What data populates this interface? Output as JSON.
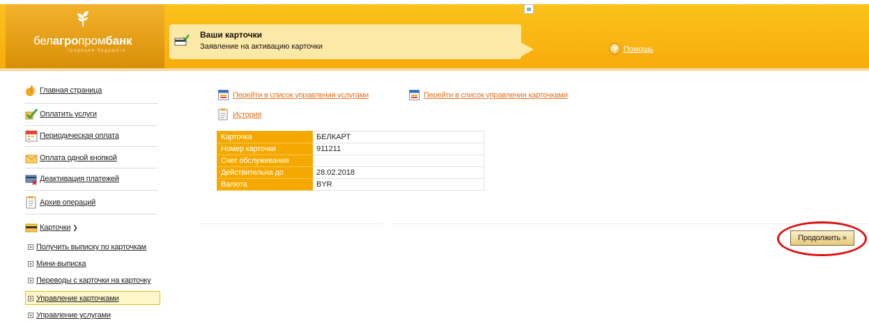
{
  "header": {
    "logo": {
      "part1": "бел",
      "part2": "агро",
      "part3": "пром",
      "part4": "банк",
      "tagline": "традиции будущего"
    },
    "notice": {
      "title": "Ваши карточки",
      "subtitle": "Заявление на активацию карточки"
    },
    "help_label": "Помощь",
    "colors": {
      "accent": "#f7ac0c",
      "notice_bg": "#fde9a7"
    }
  },
  "sidebar": {
    "items": [
      {
        "label": "Главная страница",
        "icon": "hand-icon"
      },
      {
        "label": "Оплатить услуги",
        "icon": "checkmark-icon"
      },
      {
        "label": "Периодическая оплата",
        "icon": "calendar-icon"
      },
      {
        "label": "Оплата одной кнопкой",
        "icon": "envelope-icon"
      },
      {
        "label": "Деактивация платежей",
        "icon": "card-cancel-icon"
      },
      {
        "label": "Архив операций",
        "icon": "document-icon"
      },
      {
        "label": "Карточки",
        "icon": "card-icon",
        "expanded": true
      }
    ],
    "sub_items": [
      {
        "label": "Получить выписку по карточкам"
      },
      {
        "label": "Мини-выписка"
      },
      {
        "label": "Переводы с карточки на карточку"
      },
      {
        "label": "Управление карточками",
        "active": true
      },
      {
        "label": "Управление услугами"
      }
    ]
  },
  "main": {
    "links": {
      "services": "Перейти в список управления услугами",
      "cards": "Перейти в список управления карточками",
      "history": "История"
    },
    "card_table": {
      "rows": [
        {
          "key": "Карточка",
          "value": "БЕЛКАРТ"
        },
        {
          "key": "Номер карточки",
          "value": "911211"
        },
        {
          "key": "Счет обслуживания",
          "value": ""
        },
        {
          "key": "Действительна до",
          "value": "28.02.2018"
        },
        {
          "key": "Валюта",
          "value": "BYR"
        }
      ]
    },
    "continue_label": "Продолжить »",
    "highlight_color": "#e01010"
  }
}
